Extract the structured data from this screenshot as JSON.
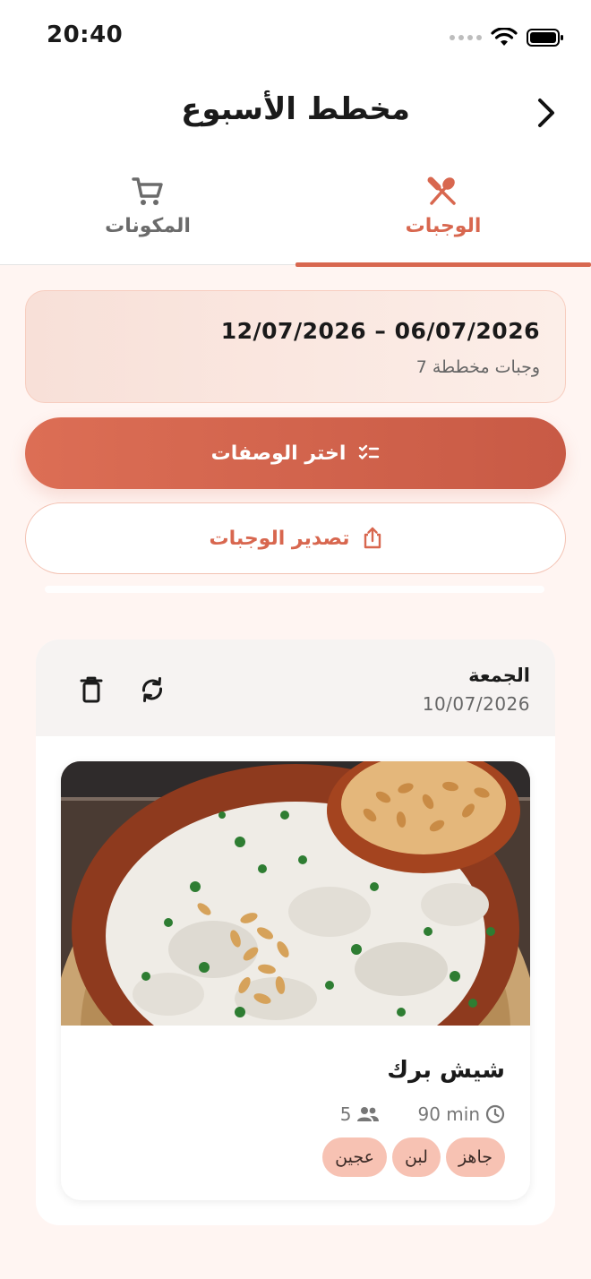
{
  "status_bar": {
    "time": "20:40"
  },
  "header": {
    "title": "مخطط الأسبوع"
  },
  "tabs": [
    {
      "label": "الوجبات",
      "icon": "utensils-icon",
      "active": true
    },
    {
      "label": "المكونات",
      "icon": "cart-icon",
      "active": false
    }
  ],
  "summary": {
    "date_range": "12/07/2026 – 06/07/2026",
    "count": "7 وجبات مخططة"
  },
  "actions": {
    "choose_recipes": "اختر الوصفات",
    "export_meals": "تصدير الوجبات"
  },
  "day": {
    "name": "الجمعة",
    "date": "10/07/2026"
  },
  "recipe": {
    "title": "شيش برك",
    "time": "90 min",
    "servings": "5",
    "tags": [
      "جاهز",
      "لبن",
      "عجين"
    ]
  },
  "colors": {
    "accent": "#d8674f",
    "tag_bg": "#f7c2b3",
    "page_bg": "#fff5f2"
  }
}
